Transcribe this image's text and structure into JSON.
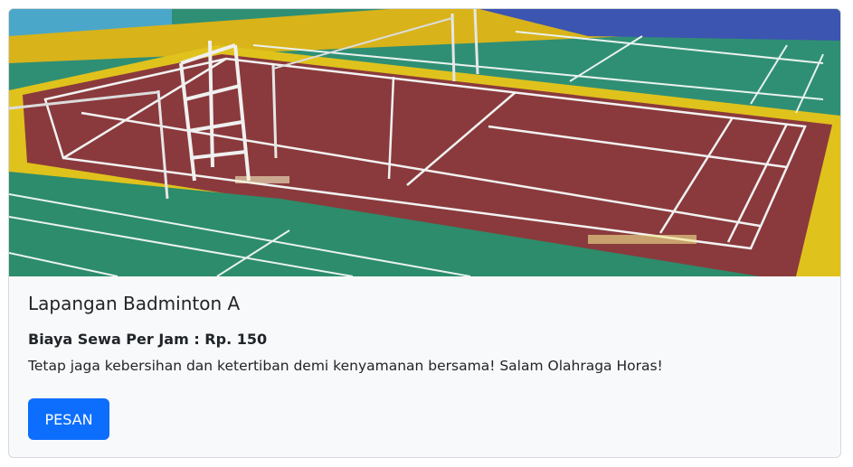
{
  "card": {
    "image_alt": "badminton-court-photo",
    "title": "Lapangan Badminton A",
    "price_text": "Biaya Sewa Per Jam : Rp. 150",
    "description": "Tetap jaga kebersihan dan ketertiban demi kenyamanan bersama! Salam Olahraga Horas!",
    "button_label": "PESAN"
  },
  "colors": {
    "button": "#0d6efd",
    "court_red": "#8a3a3c",
    "court_green": "#2a8a6a",
    "court_yellow": "#e0c01a",
    "card_bg": "#f8f9fa"
  }
}
